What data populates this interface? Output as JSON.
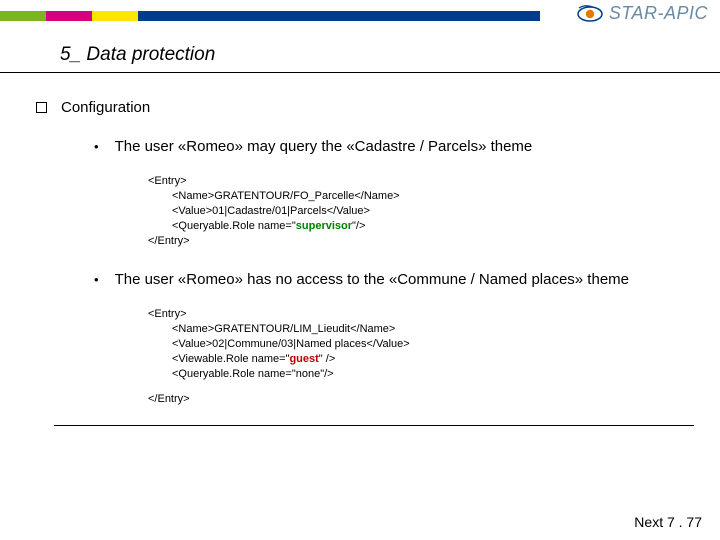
{
  "brand": {
    "name": "STAR-APIC"
  },
  "title": "5_ Data protection",
  "section": {
    "label": "Configuration"
  },
  "bullets": [
    {
      "text": "The user «Romeo» may query the «Cadastre / Parcels» theme",
      "code": {
        "open": "<Entry>",
        "lines": [
          {
            "text": "<Name>GRATENTOUR/FO_Parcelle</Name>"
          },
          {
            "text": "<Value>01|Cadastre/01|Parcels</Value>"
          },
          {
            "pre": "<Queryable.Role name=\"",
            "hl": "supervisor",
            "hl_class": "kw-green",
            "post": "\"/>"
          }
        ],
        "close": "</Entry>"
      }
    },
    {
      "text": "The user «Romeo» has no access to the  «Commune / Named places» theme",
      "code": {
        "open": "<Entry>",
        "lines": [
          {
            "text": "<Name>GRATENTOUR/LIM_Lieudit</Name>"
          },
          {
            "text": "<Value>02|Commune/03|Named places</Value>"
          },
          {
            "pre": "<Viewable.Role name=\"",
            "hl": "guest",
            "hl_class": "kw-red",
            "post": "\" />"
          },
          {
            "text": "<Queryable.Role name=\"none\"/>"
          }
        ],
        "close": "</Entry>",
        "close_spaced": true
      }
    }
  ],
  "footer": "Next 7 . 77"
}
